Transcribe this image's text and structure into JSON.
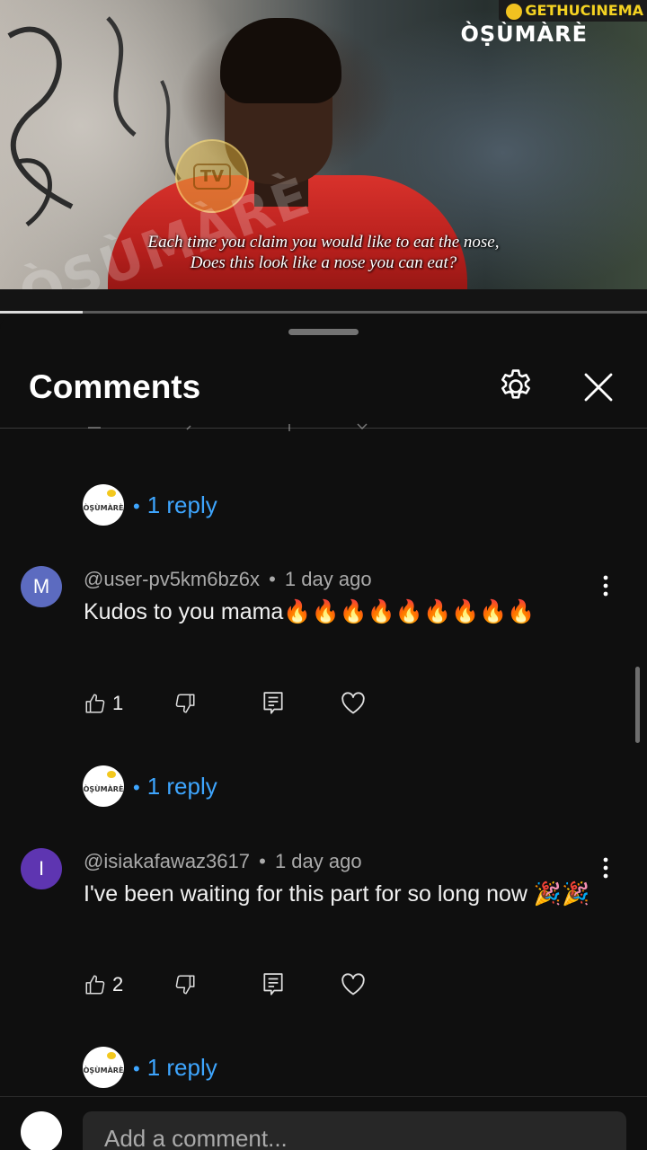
{
  "video": {
    "subtitle_line1": "Each time you claim you would like to eat the nose,",
    "subtitle_line2": "Does this look like a nose you can eat?",
    "brand": "ÒṢÙMÀRÈ",
    "watermark": "ÒṢÙMÀRÈ",
    "channel_badge": "GETHUCINEMA",
    "tv_mark": "TV",
    "progress_fraction": 0.128
  },
  "comments_panel": {
    "title": "Comments",
    "add_comment_placeholder": "Add a comment..."
  },
  "reply_avatar_text": "ÒṢÙMÀRÈ",
  "comments": [
    {
      "reply_summary": "1 reply"
    },
    {
      "avatar_letter": "M",
      "avatar_color": "#5c6bc0",
      "author": "@user-pv5km6bz6x",
      "time": "1 day ago",
      "text": "Kudos to you mama🔥🔥🔥🔥🔥🔥🔥🔥🔥",
      "likes": "1",
      "reply_summary": "1 reply"
    },
    {
      "avatar_letter": "I",
      "avatar_color": "#5e35b1",
      "author": "@isiakafawaz3617",
      "time": "1 day ago",
      "text": "I've been waiting for this part for so long now 🎉🎉",
      "likes": "2",
      "reply_summary": "1 reply"
    }
  ],
  "separator": "•"
}
